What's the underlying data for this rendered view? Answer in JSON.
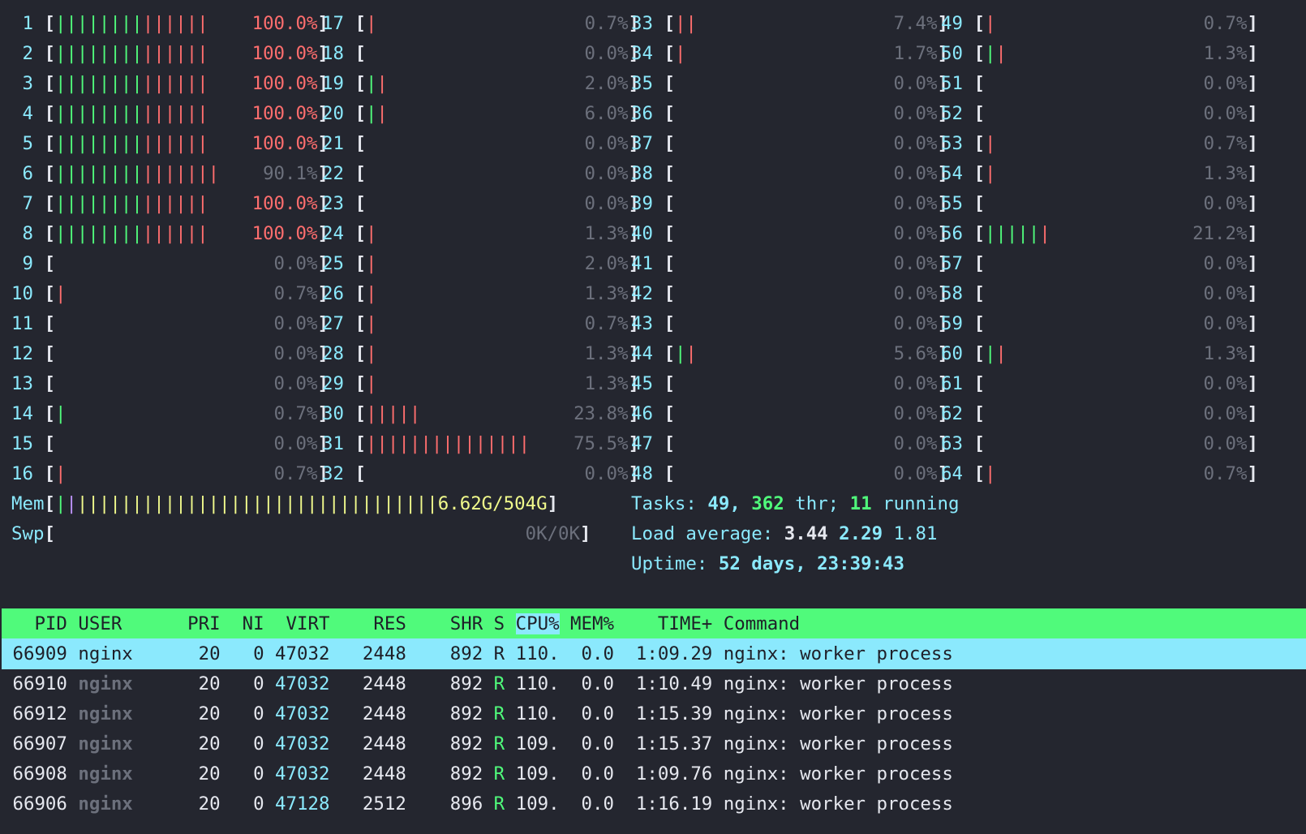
{
  "cpus": [
    {
      "id": "1",
      "pct": "100.0%",
      "green": 8,
      "red": 6
    },
    {
      "id": "2",
      "pct": "100.0%",
      "green": 8,
      "red": 6
    },
    {
      "id": "3",
      "pct": "100.0%",
      "green": 8,
      "red": 6
    },
    {
      "id": "4",
      "pct": "100.0%",
      "green": 8,
      "red": 6
    },
    {
      "id": "5",
      "pct": "100.0%",
      "green": 8,
      "red": 6
    },
    {
      "id": "6",
      "pct": "90.1%",
      "green": 8,
      "red": 7
    },
    {
      "id": "7",
      "pct": "100.0%",
      "green": 8,
      "red": 6
    },
    {
      "id": "8",
      "pct": "100.0%",
      "green": 8,
      "red": 6
    },
    {
      "id": "9",
      "pct": "0.0%",
      "green": 0,
      "red": 0
    },
    {
      "id": "10",
      "pct": "0.7%",
      "green": 0,
      "red": 1
    },
    {
      "id": "11",
      "pct": "0.0%",
      "green": 0,
      "red": 0
    },
    {
      "id": "12",
      "pct": "0.0%",
      "green": 0,
      "red": 0
    },
    {
      "id": "13",
      "pct": "0.0%",
      "green": 0,
      "red": 0
    },
    {
      "id": "14",
      "pct": "0.7%",
      "green": 1,
      "red": 0
    },
    {
      "id": "15",
      "pct": "0.0%",
      "green": 0,
      "red": 0
    },
    {
      "id": "16",
      "pct": "0.7%",
      "green": 0,
      "red": 1
    },
    {
      "id": "17",
      "pct": "0.7%",
      "green": 0,
      "red": 1
    },
    {
      "id": "18",
      "pct": "0.0%",
      "green": 0,
      "red": 0
    },
    {
      "id": "19",
      "pct": "2.0%",
      "green": 1,
      "red": 1
    },
    {
      "id": "20",
      "pct": "6.0%",
      "green": 1,
      "red": 1
    },
    {
      "id": "21",
      "pct": "0.0%",
      "green": 0,
      "red": 0
    },
    {
      "id": "22",
      "pct": "0.0%",
      "green": 0,
      "red": 0
    },
    {
      "id": "23",
      "pct": "0.0%",
      "green": 0,
      "red": 0
    },
    {
      "id": "24",
      "pct": "1.3%",
      "green": 0,
      "red": 1
    },
    {
      "id": "25",
      "pct": "2.0%",
      "green": 0,
      "red": 1
    },
    {
      "id": "26",
      "pct": "1.3%",
      "green": 0,
      "red": 1
    },
    {
      "id": "27",
      "pct": "0.7%",
      "green": 0,
      "red": 1
    },
    {
      "id": "28",
      "pct": "1.3%",
      "green": 0,
      "red": 1
    },
    {
      "id": "29",
      "pct": "1.3%",
      "green": 0,
      "red": 1
    },
    {
      "id": "30",
      "pct": "23.8%",
      "green": 0,
      "red": 5
    },
    {
      "id": "31",
      "pct": "75.5%",
      "green": 0,
      "red": 15
    },
    {
      "id": "32",
      "pct": "0.0%",
      "green": 0,
      "red": 0
    },
    {
      "id": "33",
      "pct": "7.4%",
      "green": 0,
      "red": 2
    },
    {
      "id": "34",
      "pct": "1.7%",
      "green": 0,
      "red": 1
    },
    {
      "id": "35",
      "pct": "0.0%",
      "green": 0,
      "red": 0
    },
    {
      "id": "36",
      "pct": "0.0%",
      "green": 0,
      "red": 0
    },
    {
      "id": "37",
      "pct": "0.0%",
      "green": 0,
      "red": 0
    },
    {
      "id": "38",
      "pct": "0.0%",
      "green": 0,
      "red": 0
    },
    {
      "id": "39",
      "pct": "0.0%",
      "green": 0,
      "red": 0
    },
    {
      "id": "40",
      "pct": "0.0%",
      "green": 0,
      "red": 0
    },
    {
      "id": "41",
      "pct": "0.0%",
      "green": 0,
      "red": 0
    },
    {
      "id": "42",
      "pct": "0.0%",
      "green": 0,
      "red": 0
    },
    {
      "id": "43",
      "pct": "0.0%",
      "green": 0,
      "red": 0
    },
    {
      "id": "44",
      "pct": "5.6%",
      "green": 1,
      "red": 1
    },
    {
      "id": "45",
      "pct": "0.0%",
      "green": 0,
      "red": 0
    },
    {
      "id": "46",
      "pct": "0.0%",
      "green": 0,
      "red": 0
    },
    {
      "id": "47",
      "pct": "0.0%",
      "green": 0,
      "red": 0
    },
    {
      "id": "48",
      "pct": "0.0%",
      "green": 0,
      "red": 0
    },
    {
      "id": "49",
      "pct": "0.7%",
      "green": 0,
      "red": 1
    },
    {
      "id": "50",
      "pct": "1.3%",
      "green": 1,
      "red": 1
    },
    {
      "id": "51",
      "pct": "0.0%",
      "green": 0,
      "red": 0
    },
    {
      "id": "52",
      "pct": "0.0%",
      "green": 0,
      "red": 0
    },
    {
      "id": "53",
      "pct": "0.7%",
      "green": 0,
      "red": 1
    },
    {
      "id": "54",
      "pct": "1.3%",
      "green": 0,
      "red": 1
    },
    {
      "id": "55",
      "pct": "0.0%",
      "green": 0,
      "red": 0
    },
    {
      "id": "56",
      "pct": "21.2%",
      "green": 5,
      "red": 1
    },
    {
      "id": "57",
      "pct": "0.0%",
      "green": 0,
      "red": 0
    },
    {
      "id": "58",
      "pct": "0.0%",
      "green": 0,
      "red": 0
    },
    {
      "id": "59",
      "pct": "0.0%",
      "green": 0,
      "red": 0
    },
    {
      "id": "60",
      "pct": "1.3%",
      "green": 1,
      "red": 1
    },
    {
      "id": "61",
      "pct": "0.0%",
      "green": 0,
      "red": 0
    },
    {
      "id": "62",
      "pct": "0.0%",
      "green": 0,
      "red": 0
    },
    {
      "id": "63",
      "pct": "0.0%",
      "green": 0,
      "red": 0
    },
    {
      "id": "64",
      "pct": "0.7%",
      "green": 0,
      "red": 1
    }
  ],
  "mem": {
    "label": "Mem",
    "value": "6.62G/504G",
    "green": 1,
    "purple": 1,
    "yellow": 33
  },
  "swp": {
    "label": "Swp",
    "value": "0K/0K"
  },
  "tasks": {
    "label": "Tasks:",
    "count": "49,",
    "thr": "362",
    "thr_label": "thr;",
    "running": "11",
    "running_label": "running"
  },
  "load": {
    "label": "Load average:",
    "l1": "3.44",
    "l5": "2.29",
    "l15": "1.81"
  },
  "uptime": {
    "label": "Uptime:",
    "value": "52 days, 23:39:43"
  },
  "header": [
    "PID",
    "USER",
    "PRI",
    "NI",
    "VIRT",
    "RES",
    "SHR",
    "S",
    "CPU%",
    "MEM%",
    "TIME+",
    "Command"
  ],
  "processes": [
    {
      "pid": "66909",
      "user": "nginx",
      "pri": "20",
      "ni": "0",
      "virt": "47032",
      "res": "2448",
      "shr": "892",
      "s": "R",
      "cpu": "110.",
      "mem": "0.0",
      "time": "1:09.29",
      "cmd": "nginx: worker process"
    },
    {
      "pid": "66910",
      "user": "nginx",
      "pri": "20",
      "ni": "0",
      "virt": "47032",
      "res": "2448",
      "shr": "892",
      "s": "R",
      "cpu": "110.",
      "mem": "0.0",
      "time": "1:10.49",
      "cmd": "nginx: worker process"
    },
    {
      "pid": "66912",
      "user": "nginx",
      "pri": "20",
      "ni": "0",
      "virt": "47032",
      "res": "2448",
      "shr": "892",
      "s": "R",
      "cpu": "110.",
      "mem": "0.0",
      "time": "1:15.39",
      "cmd": "nginx: worker process"
    },
    {
      "pid": "66907",
      "user": "nginx",
      "pri": "20",
      "ni": "0",
      "virt": "47032",
      "res": "2448",
      "shr": "892",
      "s": "R",
      "cpu": "109.",
      "mem": "0.0",
      "time": "1:15.37",
      "cmd": "nginx: worker process"
    },
    {
      "pid": "66908",
      "user": "nginx",
      "pri": "20",
      "ni": "0",
      "virt": "47032",
      "res": "2448",
      "shr": "892",
      "s": "R",
      "cpu": "109.",
      "mem": "0.0",
      "time": "1:09.76",
      "cmd": "nginx: worker process"
    },
    {
      "pid": "66906",
      "user": "nginx",
      "pri": "20",
      "ni": "0",
      "virt": "47128",
      "res": "2512",
      "shr": "896",
      "s": "R",
      "cpu": "109.",
      "mem": "0.0",
      "time": "1:16.19",
      "cmd": "nginx: worker process"
    }
  ]
}
